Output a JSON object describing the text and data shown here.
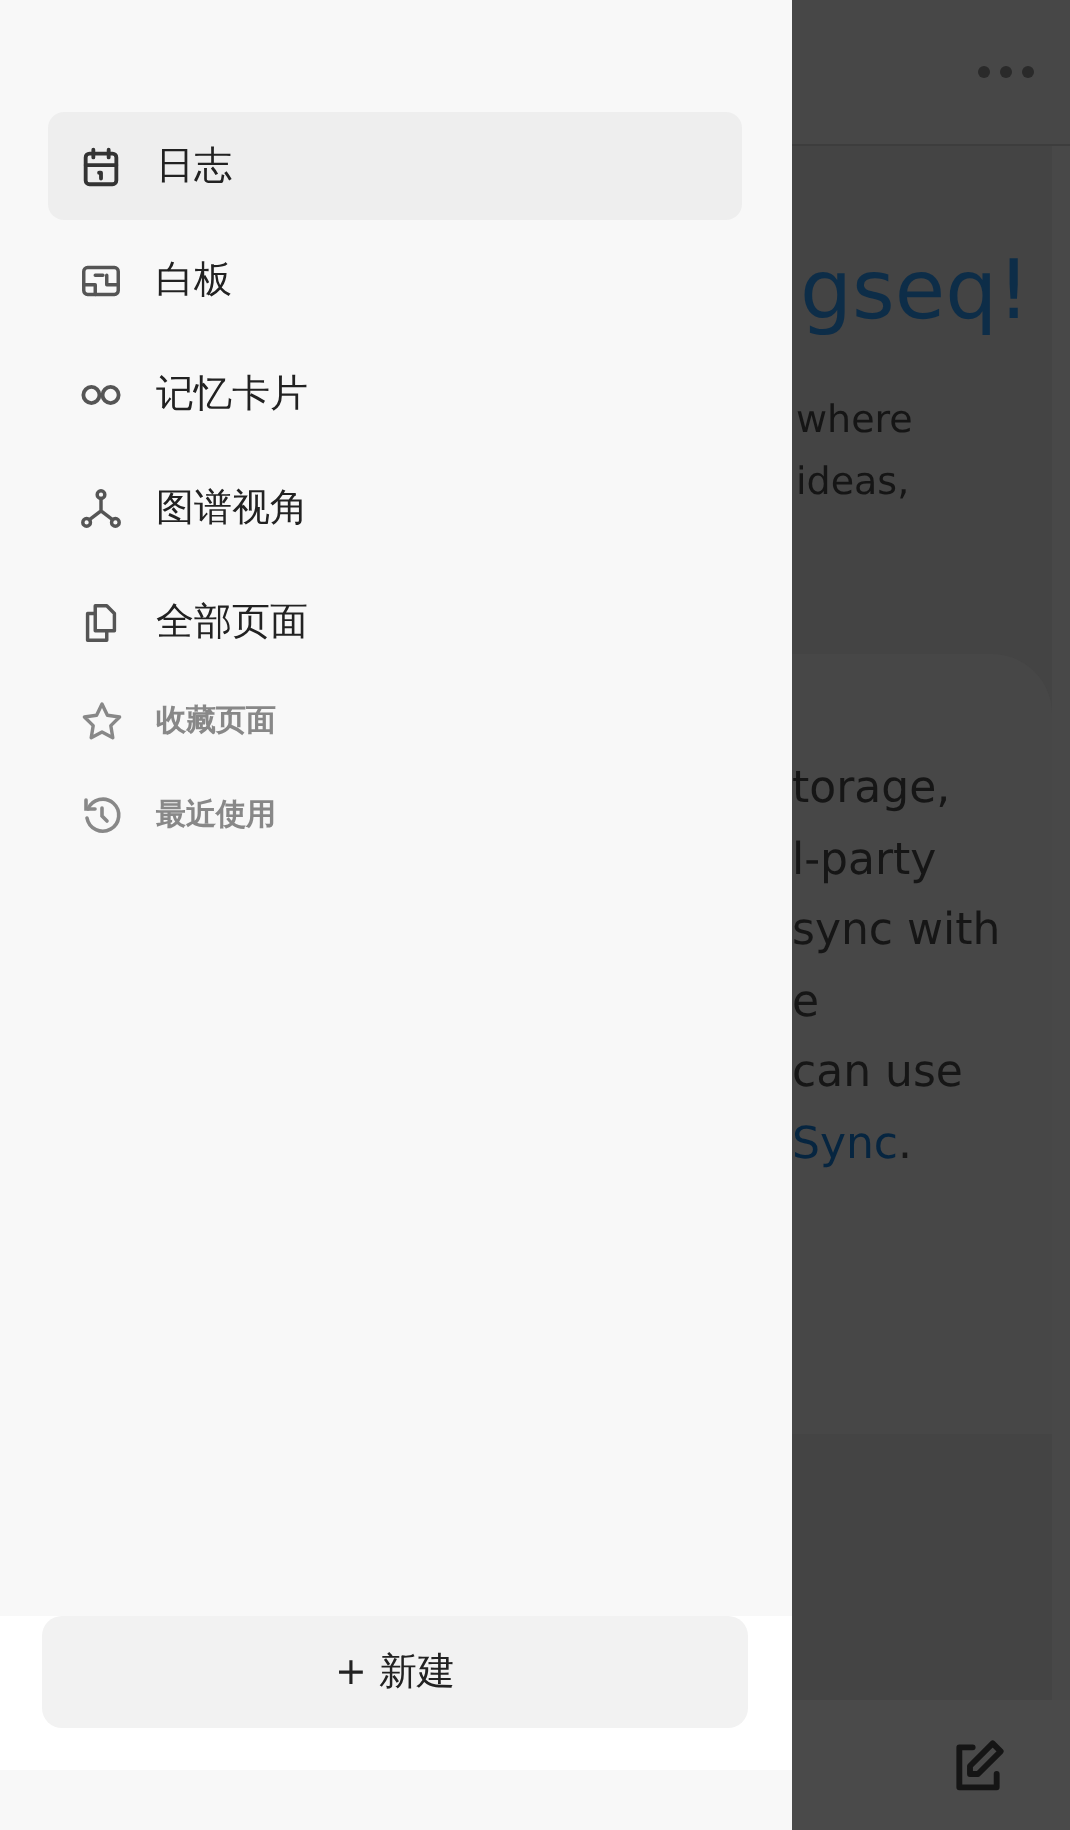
{
  "drawer": {
    "nav_items": [
      {
        "label": "日志",
        "selected": true
      },
      {
        "label": "白板",
        "selected": false
      },
      {
        "label": "记忆卡片",
        "selected": false
      },
      {
        "label": "图谱视角",
        "selected": false
      },
      {
        "label": "全部页面",
        "selected": false
      }
    ],
    "sections": [
      {
        "label": "收藏页面"
      },
      {
        "label": "最近使用"
      }
    ],
    "new_button": {
      "icon": "+",
      "label": "新建"
    }
  },
  "background_page": {
    "title": "gseq!",
    "intro_lines": [
      "where",
      "ideas,"
    ],
    "card_lines": [
      "torage,",
      "l-party",
      "sync with",
      "e",
      "can use"
    ],
    "card_link": "Sync",
    "card_end": "."
  }
}
